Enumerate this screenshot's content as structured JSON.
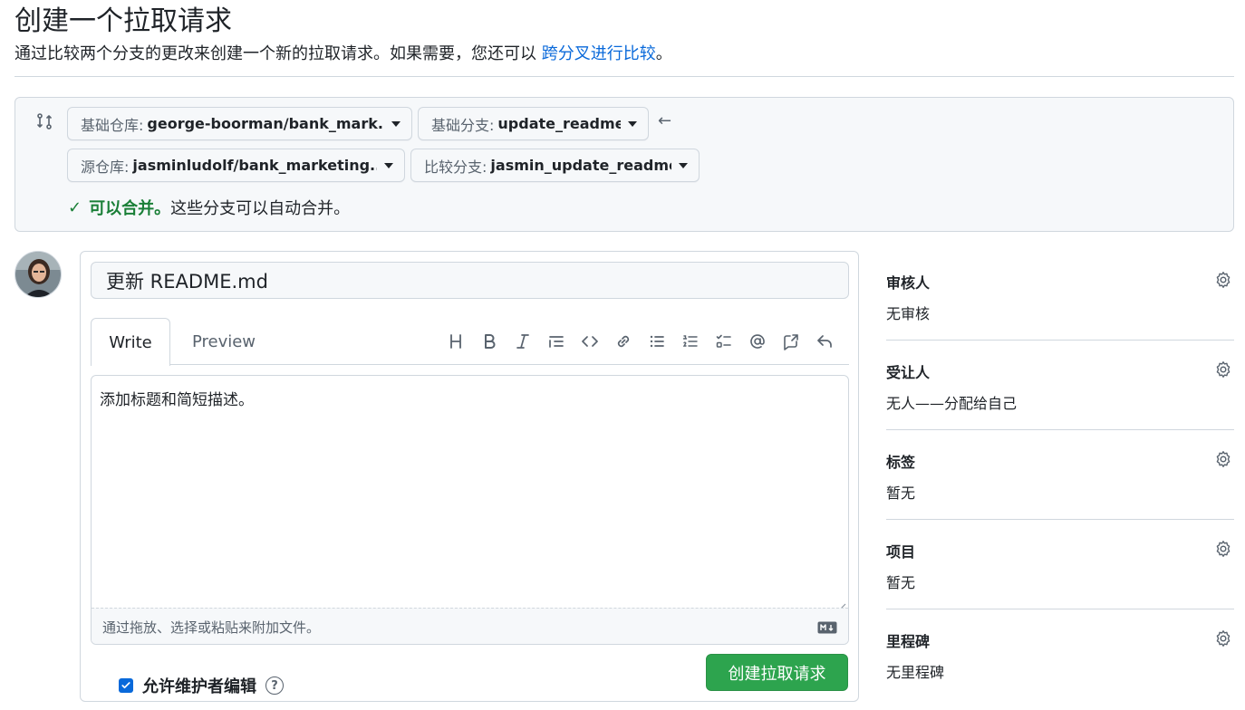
{
  "header": {
    "title": "创建一个拉取请求",
    "subtitle_prefix": "通过比较两个分支的更改来创建一个新的拉取请求。如果需要，您还可以",
    "subtitle_link": "跨分叉进行比较",
    "subtitle_suffix": "。"
  },
  "compare": {
    "base_repo_label": "基础仓库:",
    "base_repo_value": "george-boorman/bank_mark...",
    "base_branch_label": "基础分支:",
    "base_branch_value": "update_readme",
    "head_repo_label": "源仓库:",
    "head_repo_value": "jasminludolf/bank_marketing...",
    "compare_branch_label": "比较分支:",
    "compare_branch_value": "jasmin_update_readme",
    "merge_ok": "可以合并。",
    "merge_msg": "这些分支可以自动合并。",
    "status_color": "#1a7f37"
  },
  "composer": {
    "title_value": "更新 README.md",
    "tabs": [
      {
        "label": "Write",
        "active": true
      },
      {
        "label": "Preview",
        "active": false
      }
    ],
    "toolbar": [
      "heading-icon",
      "bold-icon",
      "italic-icon",
      "quote-icon",
      "code-icon",
      "link-icon",
      "bulleted-list-icon",
      "numbered-list-icon",
      "task-list-icon",
      "mention-icon",
      "cross-reference-icon",
      "reply-icon"
    ],
    "body_text": "添加标题和简短描述。",
    "attach_hint": "通过拖放、选择或粘贴来附加文件。",
    "create_button": "创建拉取请求",
    "allow_edits_label": "允许维护者编辑",
    "allow_edits_checked": true,
    "accent_color": "#2da44e"
  },
  "sidebar": {
    "sections": [
      {
        "heading": "审核人",
        "value": "无审核"
      },
      {
        "heading": "受让人",
        "value": "无人——分配给自己"
      },
      {
        "heading": "标签",
        "value": "暂无"
      },
      {
        "heading": "项目",
        "value": "暂无"
      },
      {
        "heading": "里程碑",
        "value": "无里程碑"
      }
    ]
  }
}
